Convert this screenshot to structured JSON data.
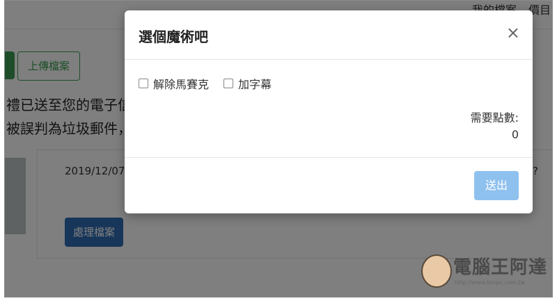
{
  "background": {
    "top_links": [
      "我的檔案",
      "價目"
    ],
    "upload_button": "上傳檔案",
    "line1": "禮已送至您的電子信",
    "line2": "被誤判為垃圾郵件，",
    "date_fragment": "2019/12/07",
    "question_fragment": "?",
    "process_button": "處理檔案"
  },
  "modal": {
    "title": "選個魔術吧",
    "close_glyph": "×",
    "options": [
      {
        "label": "解除馬賽克",
        "checked": false
      },
      {
        "label": "加字幕",
        "checked": false
      }
    ],
    "points_label": "需要點數:",
    "points_value": "0",
    "submit_label": "送出"
  },
  "watermark": {
    "text": "電腦王阿達",
    "url": "http://www.kocpc.com.tw"
  },
  "colors": {
    "overlay": "rgba(0,0,0,0.5)",
    "submit_bg": "#8fc1ee",
    "green": "#3b9d52",
    "blue": "#2f6db5"
  }
}
